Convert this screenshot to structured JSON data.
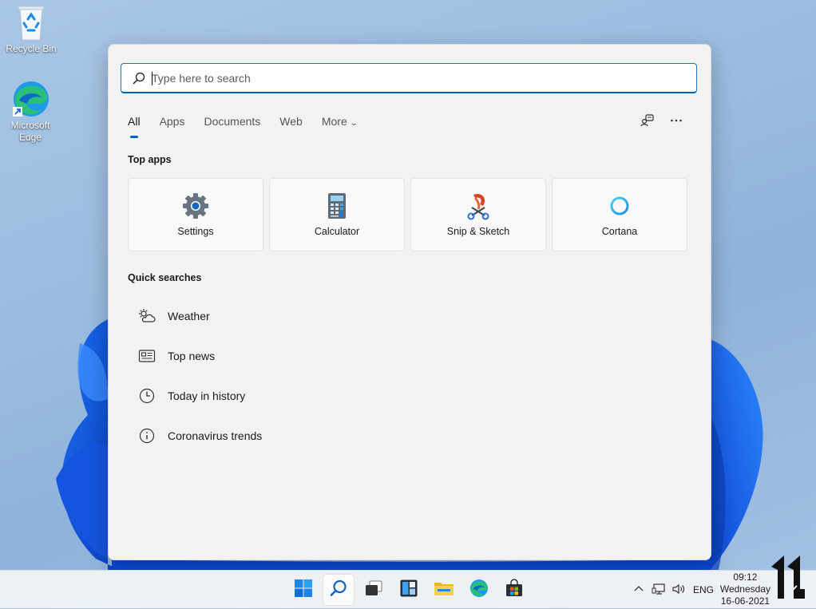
{
  "desktop": {
    "recycle_bin_label": "Recycle Bin",
    "edge_label": "Microsoft Edge",
    "edge_label_line1": "Microsoft",
    "edge_label_line2": "Edge"
  },
  "search": {
    "placeholder": "Type here to search",
    "value": "",
    "icon": "search-icon"
  },
  "tabs": [
    {
      "label": "All",
      "active": true
    },
    {
      "label": "Apps"
    },
    {
      "label": "Documents"
    },
    {
      "label": "Web"
    },
    {
      "label": "More",
      "has_dropdown": true
    }
  ],
  "header_actions": [
    {
      "icon": "feedback-icon"
    },
    {
      "icon": "more-options-icon"
    }
  ],
  "top_apps": {
    "title": "Top apps",
    "items": [
      {
        "label": "Settings",
        "icon": "settings-icon"
      },
      {
        "label": "Calculator",
        "icon": "calculator-icon"
      },
      {
        "label": "Snip & Sketch",
        "icon": "snip-sketch-icon"
      },
      {
        "label": "Cortana",
        "icon": "cortana-icon"
      }
    ]
  },
  "quick_searches": {
    "title": "Quick searches",
    "items": [
      {
        "label": "Weather",
        "icon": "weather-icon"
      },
      {
        "label": "Top news",
        "icon": "news-icon"
      },
      {
        "label": "Today in history",
        "icon": "clock-icon"
      },
      {
        "label": "Coronavirus trends",
        "icon": "info-icon"
      }
    ]
  },
  "taskbar": {
    "pinned": [
      {
        "icon": "start-icon"
      },
      {
        "icon": "search-icon",
        "active": true
      },
      {
        "icon": "task-view-icon"
      },
      {
        "icon": "widgets-icon"
      },
      {
        "icon": "file-explorer-icon"
      },
      {
        "icon": "edge-icon"
      },
      {
        "icon": "store-icon"
      }
    ],
    "tray": {
      "language": "ENG",
      "time": "09:12",
      "day": "Wednesday",
      "date": "16-06-2021"
    }
  },
  "colors": {
    "accent": "#005fb8",
    "panel_bg": "#f2f2f2",
    "taskbar_bg": "#eef1f4"
  }
}
